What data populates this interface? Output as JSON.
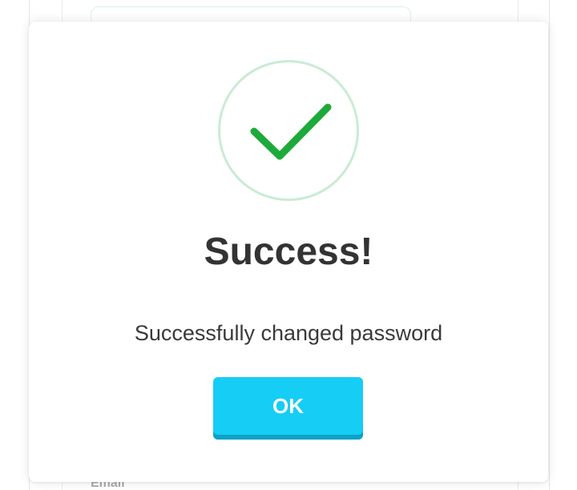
{
  "background": {
    "partial_label": "Email"
  },
  "dialog": {
    "icon": "check-icon",
    "title": "Success!",
    "message": "Successfully changed password",
    "ok_label": "OK"
  },
  "colors": {
    "check": "#1daa3a",
    "ring": "#c9ecd4",
    "button": "#15cdf5",
    "button_shadow": "#0aa2c8",
    "title_text": "#333333"
  }
}
